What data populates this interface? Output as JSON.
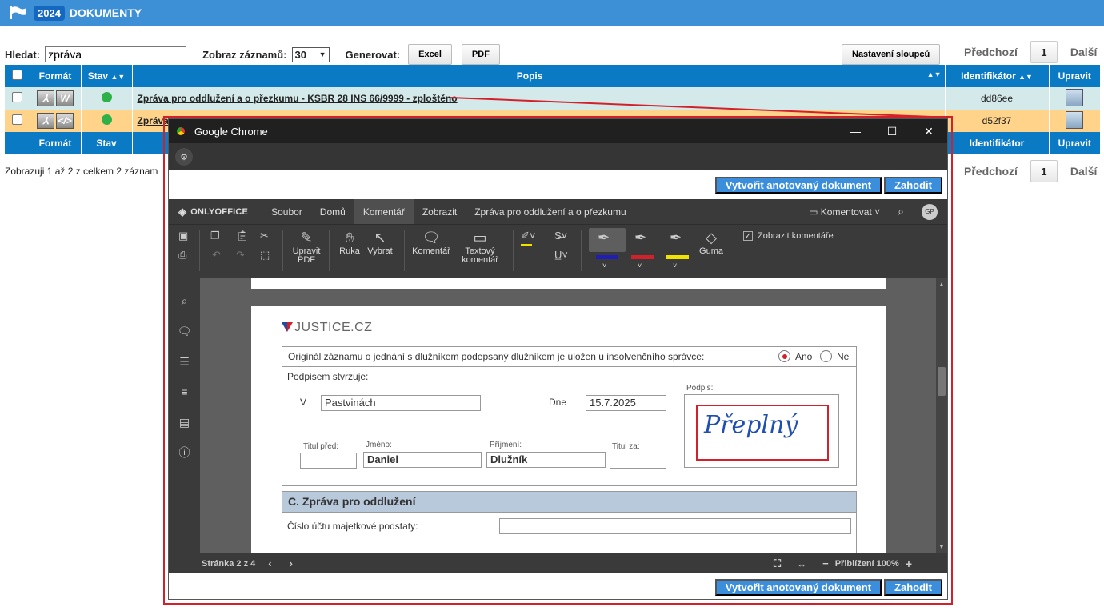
{
  "topbar": {
    "year": "2024",
    "title": "DOKUMENTY"
  },
  "controls": {
    "search_label": "Hledat:",
    "search_value": "zpráva",
    "show_label": "Zobraz záznamů:",
    "show_value": "30",
    "generate_label": "Generovat:",
    "excel": "Excel",
    "pdf": "PDF",
    "columns_button": "Nastavení sloupců"
  },
  "pager": {
    "prev": "Předchozí",
    "page": "1",
    "next": "Další"
  },
  "table": {
    "headers": {
      "format": "Formát",
      "status": "Stav",
      "desc": "Popis",
      "id": "Identifikátor",
      "edit": "Upravit"
    },
    "rows": [
      {
        "desc": "Zpráva pro oddlužení a o přezkumu - KSBR 28 INS 66/9999 - zploštěno",
        "id": "dd86ee"
      },
      {
        "desc": "Zpráva p",
        "id": "d52f37"
      }
    ]
  },
  "info": "Zobrazuji 1 až 2 z celkem 2 záznam",
  "chrome": {
    "title": "Google Chrome"
  },
  "actions": {
    "create": "Vytvořit anotovaný dokument",
    "discard": "Zahodit"
  },
  "oo": {
    "logo": "ONLYOFFICE",
    "menu": [
      "Soubor",
      "Domů",
      "Komentář",
      "Zobrazit",
      "Zpráva pro oddlužení a o přezkumu"
    ],
    "comment_mode": "Komentovat",
    "avatar": "GP",
    "tools": {
      "edit_pdf": "Upravit PDF",
      "hand": "Ruka",
      "select": "Vybrat",
      "comment": "Komentář",
      "text_comment": "Textový komentář",
      "eraser": "Guma",
      "show_comments": "Zobrazit komentáře"
    },
    "status": {
      "page": "Stránka 2 z 4",
      "zoom": "Přiblížení 100%"
    }
  },
  "doc": {
    "brand": "JUSTICE.CZ",
    "original_q": "Originál záznamu o jednání s dlužníkem podepsaný dlužníkem je uložen u insolvenčního správce:",
    "yes": "Ano",
    "no": "Ne",
    "sign_confirm": "Podpisem stvrzuje:",
    "place_label": "V",
    "place_value": "Pastvinách",
    "date_label": "Dne",
    "date_value": "15.7.2025",
    "signature_label": "Podpis:",
    "signature_text": "Přeplný",
    "title_before": "Titul před:",
    "name_label": "Jméno:",
    "name_value": "Daniel",
    "surname_label": "Příjmení:",
    "surname_value": "Dlužník",
    "title_after": "Titul za:",
    "section_c": "C. Zpráva pro oddlužení",
    "account_label": "Číslo účtu majetkové podstaty:"
  },
  "colors": {
    "accent": "#0b7ac4",
    "highlight_red": "#d3212b",
    "pen_blue": "#1f1fb8",
    "pen_red": "#d3212b",
    "pen_yellow": "#f2e200"
  }
}
